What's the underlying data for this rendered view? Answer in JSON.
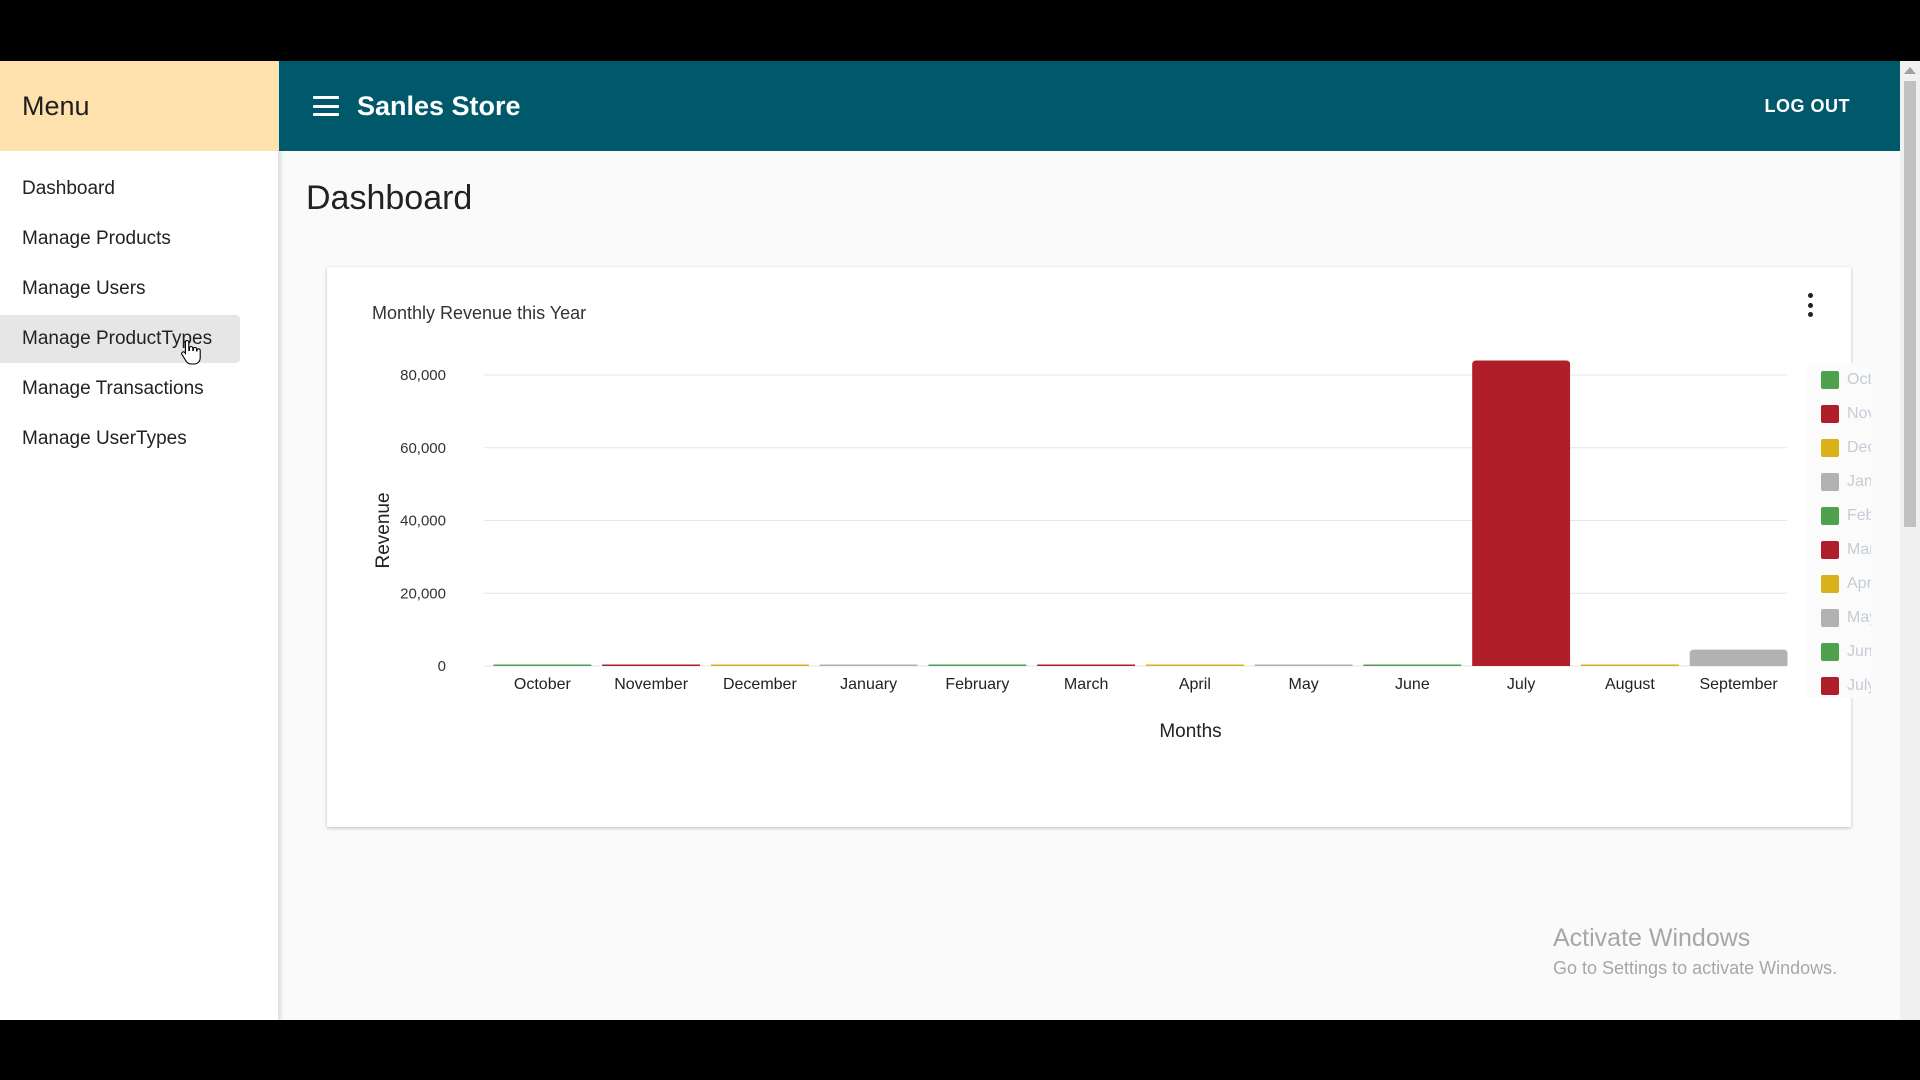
{
  "sidebar": {
    "title": "Menu",
    "items": [
      {
        "label": "Dashboard"
      },
      {
        "label": "Manage Products"
      },
      {
        "label": "Manage Users"
      },
      {
        "label": "Manage ProductTypes"
      },
      {
        "label": "Manage Transactions"
      },
      {
        "label": "Manage UserTypes"
      }
    ]
  },
  "header": {
    "title": "Sanles Store",
    "logout_label": "LOG OUT",
    "menu_icon": "hamburger-menu-icon"
  },
  "page": {
    "title": "Dashboard"
  },
  "card": {
    "title": "Monthly Revenue this Year",
    "menu_icon": "more-vert-icon"
  },
  "chart_data": {
    "type": "bar",
    "categories": [
      "October",
      "November",
      "December",
      "January",
      "February",
      "March",
      "April",
      "May",
      "June",
      "July",
      "August",
      "September"
    ],
    "values": [
      0,
      0,
      0,
      0,
      0,
      0,
      0,
      0,
      0,
      84000,
      0,
      4500
    ],
    "colors": [
      "#4ea24e",
      "#b01e2a",
      "#d9b11a",
      "#b2b2b2",
      "#4ea24e",
      "#b01e2a",
      "#d9b11a",
      "#b2b2b2",
      "#4ea24e",
      "#b01e2a",
      "#d9b11a",
      "#b2b2b2"
    ],
    "title": "",
    "xlabel": "Months",
    "ylabel": "Revenue",
    "ylim": [
      0,
      80000
    ],
    "yticks": [
      "0",
      "20,000",
      "40,000",
      "60,000",
      "80,000"
    ],
    "grid": true,
    "legend": {
      "placement": "right",
      "labels": [
        "Octo",
        "Nov",
        "Dec",
        "Jan",
        "Feb",
        "Mar",
        "Apr",
        "May",
        "Jun",
        "July"
      ]
    }
  },
  "watermark": {
    "title": "Activate Windows",
    "subtitle": "Go to Settings to activate Windows."
  },
  "colors": {
    "topbar": "#00596b",
    "sidebar_header": "#ffe1ae"
  }
}
